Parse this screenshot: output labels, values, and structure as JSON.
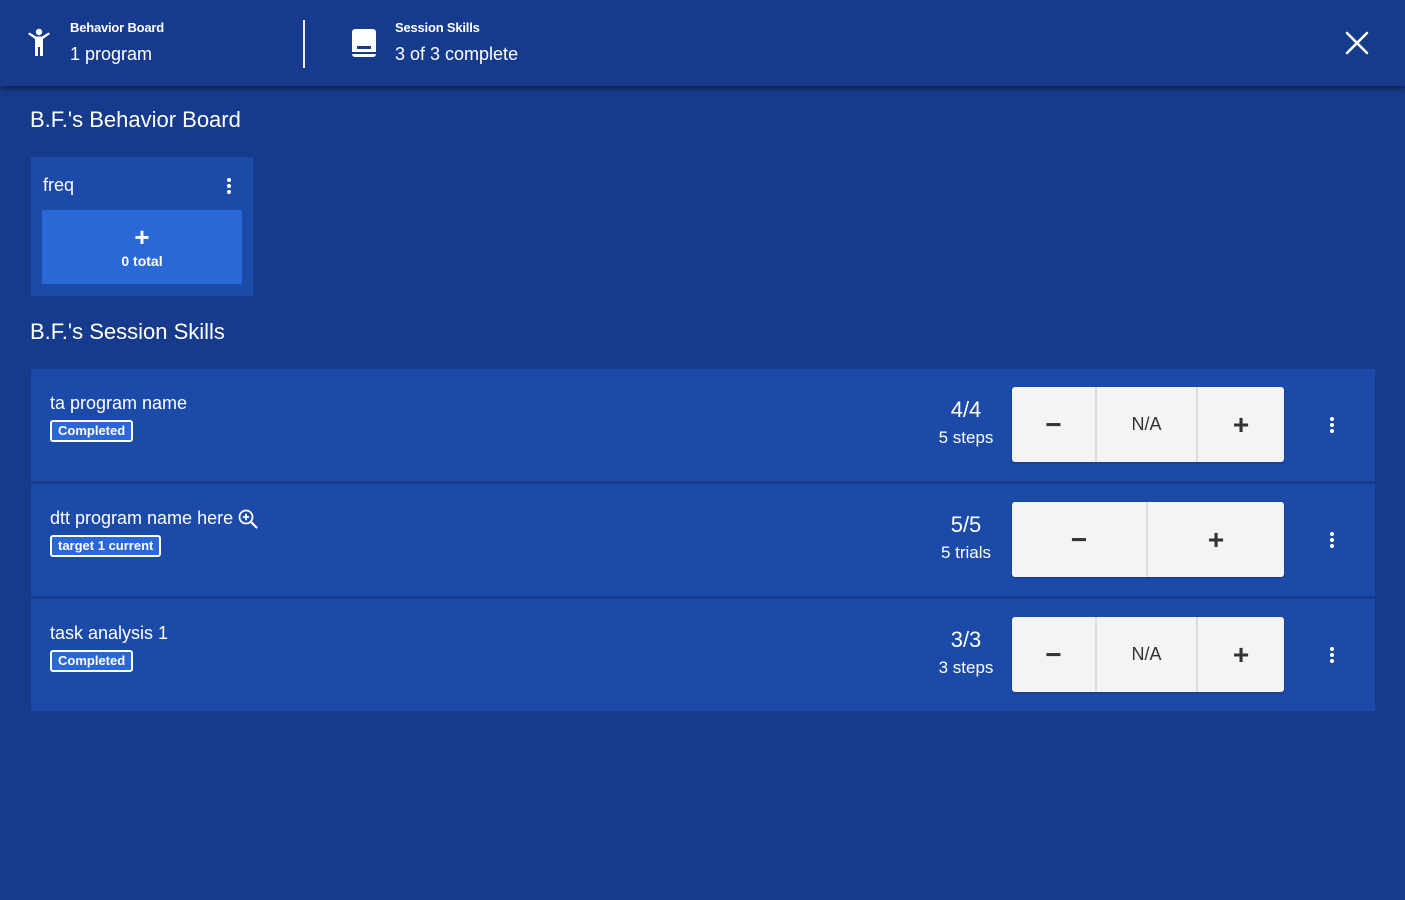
{
  "header": {
    "behavior_board": {
      "label": "Behavior Board",
      "value": "1 program"
    },
    "session_skills": {
      "label": "Session Skills",
      "value": "3 of 3 complete"
    }
  },
  "behavior_board": {
    "title": "B.F.'s Behavior Board",
    "cards": [
      {
        "name": "freq",
        "button_icon": "+",
        "total": "0 total"
      }
    ]
  },
  "session_skills": {
    "title": "B.F.'s Session Skills",
    "rows": [
      {
        "name": "ta program name",
        "badge": "Completed",
        "count": "4/4",
        "sub": "5 steps",
        "minus": "−",
        "na": "N/A",
        "plus": "+"
      },
      {
        "name": "dtt program name here",
        "badge": "target 1 current",
        "count": "5/5",
        "sub": "5 trials",
        "minus": "−",
        "plus": "+"
      },
      {
        "name": "task analysis 1",
        "badge": "Completed",
        "count": "3/3",
        "sub": "3 steps",
        "minus": "−",
        "na": "N/A",
        "plus": "+"
      }
    ]
  },
  "icons": {
    "behavior": "person-icon",
    "skills": "book-icon",
    "close": "close-icon",
    "menu": "more-vertical-icon",
    "zoom": "zoom-in-icon"
  },
  "colors": {
    "background": "#163b8c",
    "card": "#1c4aa8",
    "button": "#2a68d8",
    "control": "#f4f4f4"
  }
}
